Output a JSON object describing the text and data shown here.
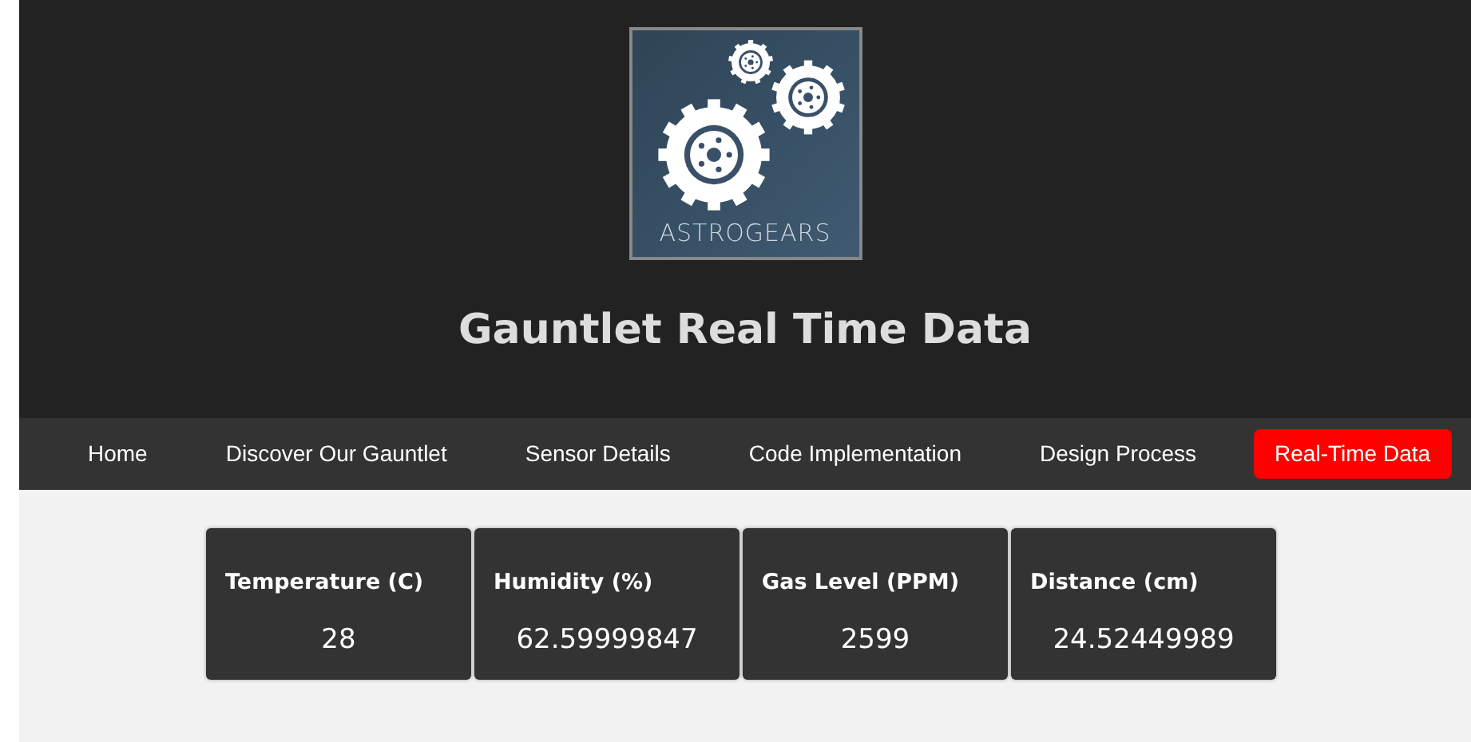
{
  "logo": {
    "text": "ASTROGEARS"
  },
  "title": "Gauntlet Real Time Data",
  "nav": [
    {
      "label": "Home",
      "selected": false
    },
    {
      "label": "Discover Our Gauntlet",
      "selected": false
    },
    {
      "label": "Sensor Details",
      "selected": false
    },
    {
      "label": "Code Implementation",
      "selected": false
    },
    {
      "label": "Design Process",
      "selected": false
    },
    {
      "label": "Real-Time Data",
      "selected": true
    }
  ],
  "readings": [
    {
      "label": "Temperature (C)",
      "value": "28"
    },
    {
      "label": "Humidity (%)",
      "value": "62.59999847"
    },
    {
      "label": "Gas Level (PPM)",
      "value": "2599"
    },
    {
      "label": "Distance (cm)",
      "value": "24.52449989"
    }
  ]
}
